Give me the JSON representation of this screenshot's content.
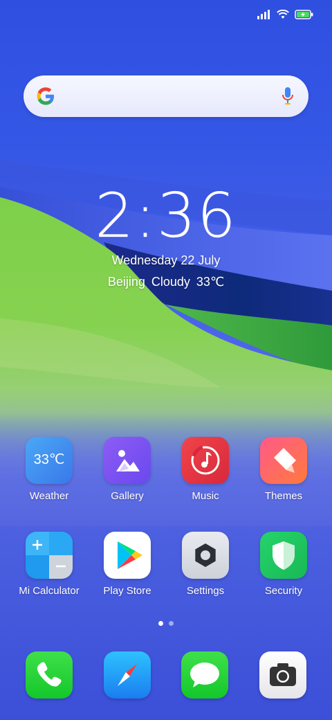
{
  "status_bar": {
    "icons": [
      "signal-icon",
      "wifi-icon",
      "battery-charging-icon"
    ]
  },
  "search": {
    "logo": "google-logo-icon",
    "mic": "microphone-icon"
  },
  "clock": {
    "time": "2:36",
    "date": "Wednesday 22 July",
    "city": "Beijing",
    "condition": "Cloudy",
    "temperature": "33℃"
  },
  "apps": [
    {
      "label": "Weather",
      "icon_text": "33℃"
    },
    {
      "label": "Gallery"
    },
    {
      "label": "Music"
    },
    {
      "label": "Themes"
    },
    {
      "label": "Mi Calculator"
    },
    {
      "label": "Play Store"
    },
    {
      "label": "Settings"
    },
    {
      "label": "Security"
    }
  ],
  "page_indicator": {
    "pages": 2,
    "current": 1
  },
  "dock": [
    "phone-icon",
    "browser-compass-icon",
    "messages-icon",
    "camera-icon"
  ]
}
